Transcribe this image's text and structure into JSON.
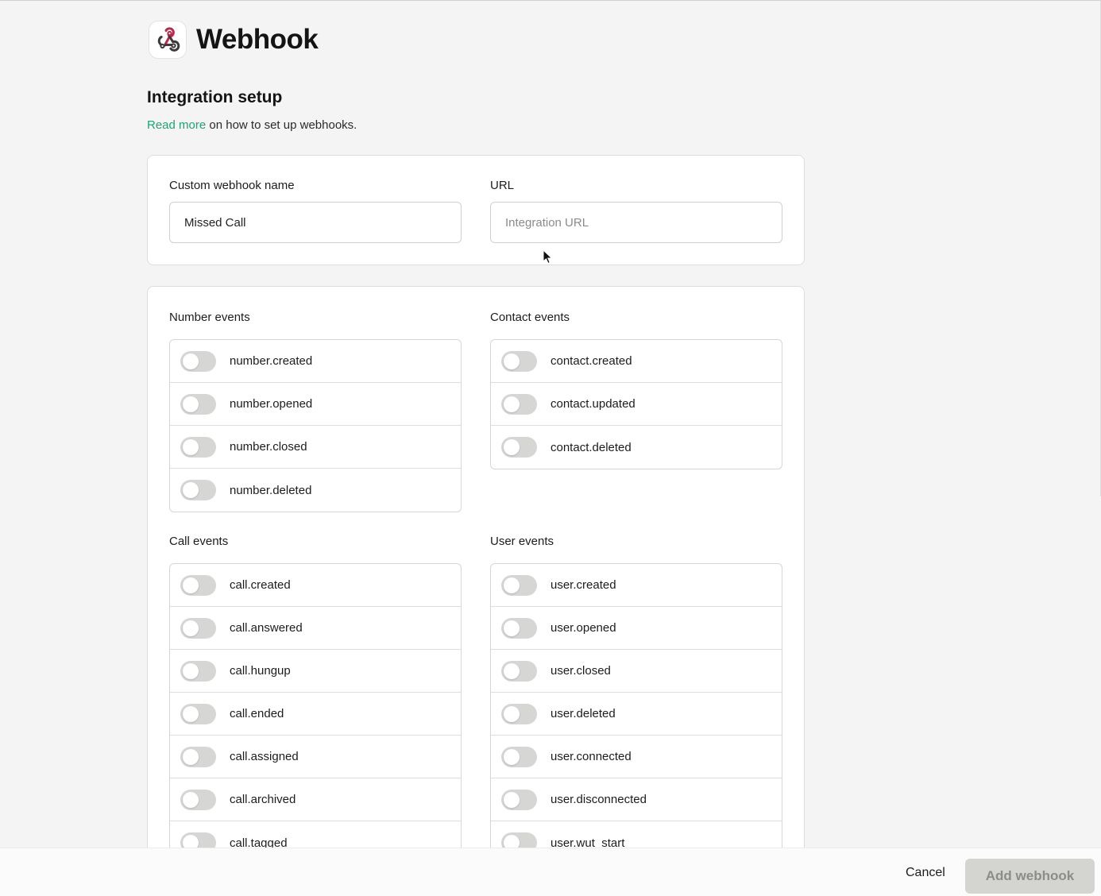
{
  "app": {
    "title": "Webhook",
    "logo_icon": "webhook-icon"
  },
  "setup": {
    "title": "Integration setup",
    "intro_link": "Read more",
    "intro_text": " on how to set up webhooks."
  },
  "form": {
    "name_label": "Custom webhook name",
    "name_value": "Missed Call",
    "url_label": "URL",
    "url_value": "",
    "url_placeholder": "Integration URL"
  },
  "events": {
    "number": {
      "label": "Number events",
      "items": [
        "number.created",
        "number.opened",
        "number.closed",
        "number.deleted"
      ]
    },
    "contact": {
      "label": "Contact events",
      "items": [
        "contact.created",
        "contact.updated",
        "contact.deleted"
      ]
    },
    "call": {
      "label": "Call events",
      "items": [
        "call.created",
        "call.answered",
        "call.hungup",
        "call.ended",
        "call.assigned",
        "call.archived",
        "call.tagged"
      ]
    },
    "user": {
      "label": "User events",
      "items": [
        "user.created",
        "user.opened",
        "user.closed",
        "user.deleted",
        "user.connected",
        "user.disconnected",
        "user.wut_start"
      ]
    }
  },
  "footer": {
    "cancel_label": "Cancel",
    "add_label": "Add webhook"
  },
  "colors": {
    "link": "#1aa57a",
    "toggle_off": "#d6d6d4",
    "primary_disabled": "#d4d4d0"
  }
}
